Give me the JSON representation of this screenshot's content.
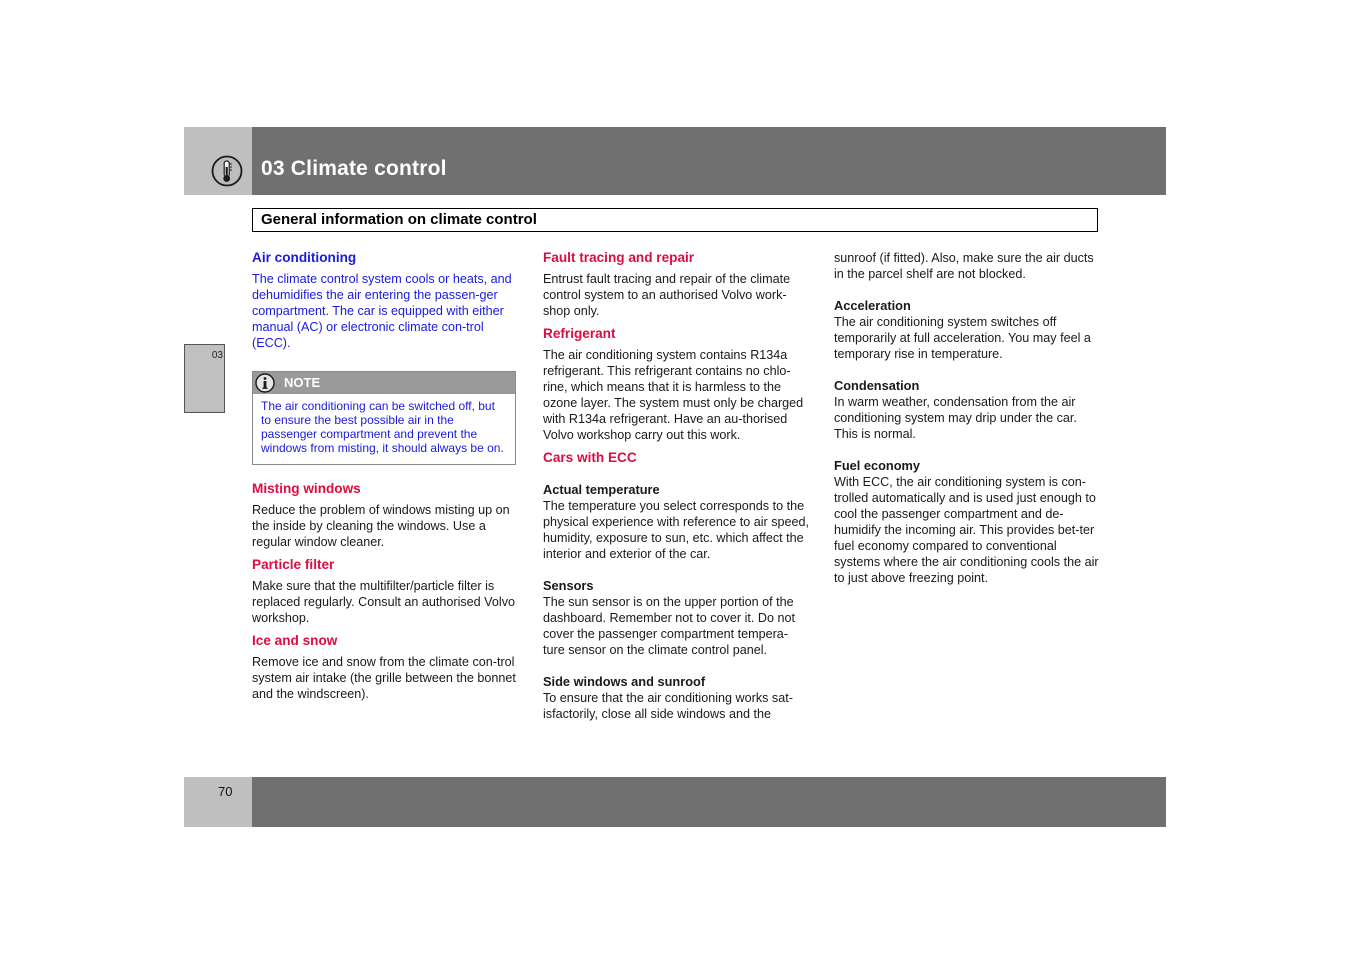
{
  "header": {
    "chapter_title": "03 Climate control",
    "chapter_icon": "thermometer-icon",
    "section_title": "General information on climate control"
  },
  "side_tab": {
    "label": "03"
  },
  "colors": {
    "header_bg": "#707070",
    "tab_bg": "#bfbfbf",
    "blue_text": "#1a1adc",
    "red_heading": "#dc0d3f"
  },
  "col1": {
    "air_conditioning": {
      "heading": "Air conditioning",
      "text": "The climate control system cools or heats, and dehumidifies the air entering the passen-ger compartment. The car is equipped with either manual (AC) or electronic climate con-trol (ECC)."
    },
    "note": {
      "label": "NOTE",
      "icon": "info-icon",
      "text": "The air conditioning can be switched off, but to ensure the best possible air in the passenger compartment and prevent the windows from misting, it should always be on."
    },
    "misting": {
      "heading": "Misting windows",
      "text": "Reduce the problem of windows misting up on the inside by cleaning the windows. Use a regular window cleaner."
    },
    "particle": {
      "heading": "Particle filter",
      "text": "Make sure that the multifilter/particle filter is replaced regularly. Consult an authorised Volvo workshop."
    },
    "ice": {
      "heading": "Ice and snow",
      "text": "Remove ice and snow from the climate con-trol system air intake (the grille between the bonnet and the windscreen)."
    }
  },
  "col2": {
    "fault": {
      "heading": "Fault tracing and repair",
      "text": "Entrust fault tracing and repair of the climate control system to an authorised Volvo work-shop only."
    },
    "refrigerant": {
      "heading": "Refrigerant",
      "text": "The air conditioning system contains R134a refrigerant. This refrigerant contains no chlo-rine, which means that it is harmless to the ozone layer. The system must only be charged with R134a refrigerant. Have an au-thorised Volvo workshop carry out this work."
    },
    "ecc": {
      "heading": "Cars with ECC"
    },
    "actual_temp": {
      "heading": "Actual temperature",
      "text": "The temperature you select corresponds to the physical experience with reference to air speed, humidity, exposure to sun, etc. which affect the interior and exterior of the car."
    },
    "sensors": {
      "heading": "Sensors",
      "text": "The sun sensor is on the upper portion of the dashboard. Remember not to cover it. Do not cover the passenger compartment tempera-ture sensor on the climate control panel."
    },
    "side_windows": {
      "heading": "Side windows and sunroof",
      "text": "To ensure that the air conditioning works sat-isfactorily, close all side windows and the"
    }
  },
  "col3": {
    "cont": {
      "text": "sunroof (if fitted). Also, make sure the air ducts in the parcel shelf are not blocked."
    },
    "acceleration": {
      "heading": "Acceleration",
      "text": "The air conditioning system switches off temporarily at full acceleration. You may feel a temporary rise in temperature."
    },
    "condensation": {
      "heading": "Condensation",
      "text": "In warm weather, condensation from the air conditioning system may drip under the car. This is normal."
    },
    "fuel": {
      "heading": "Fuel economy",
      "text": "With ECC, the air conditioning system is con-trolled automatically and is used just enough to cool the passenger compartment and de-humidify the incoming air. This provides bet-ter fuel economy compared to conventional systems where the air conditioning cools the air to just above freezing point."
    }
  },
  "footer": {
    "page_number": "70"
  }
}
